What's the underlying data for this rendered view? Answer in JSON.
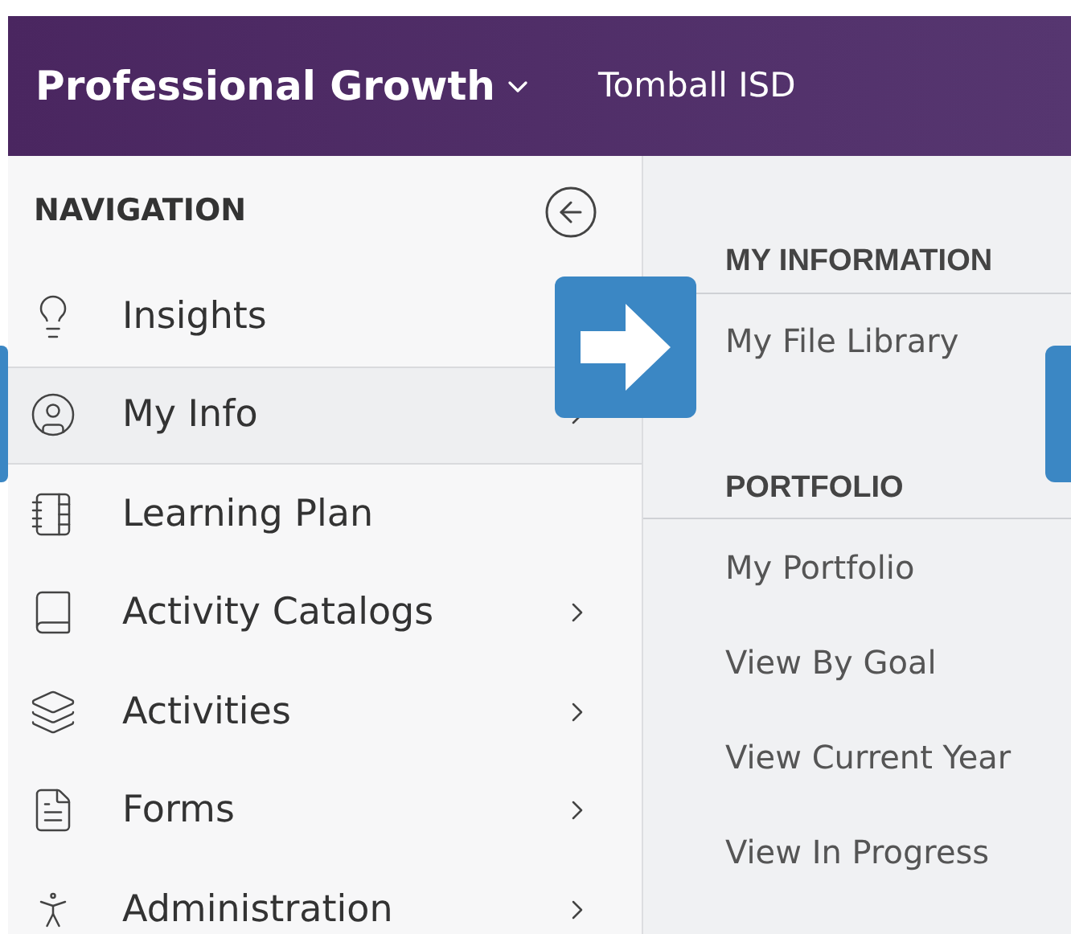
{
  "header": {
    "product": "Professional Growth",
    "district": "Tomball ISD"
  },
  "sidebar": {
    "heading": "NAVIGATION",
    "items": [
      {
        "label": "Insights",
        "selected": false,
        "has_submenu": false
      },
      {
        "label": "My Info",
        "selected": true,
        "has_submenu": true
      },
      {
        "label": "Learning Plan",
        "selected": false,
        "has_submenu": false
      },
      {
        "label": "Activity Catalogs",
        "selected": false,
        "has_submenu": true
      },
      {
        "label": "Activities",
        "selected": false,
        "has_submenu": true
      },
      {
        "label": "Forms",
        "selected": false,
        "has_submenu": true
      },
      {
        "label": "Administration",
        "selected": false,
        "has_submenu": true
      }
    ]
  },
  "submenu": {
    "sections": [
      {
        "heading": "MY INFORMATION",
        "items": [
          "My File Library"
        ]
      },
      {
        "heading": "PORTFOLIO",
        "items": [
          "My Portfolio",
          "View By Goal",
          "View Current Year",
          "View In Progress"
        ]
      }
    ]
  }
}
